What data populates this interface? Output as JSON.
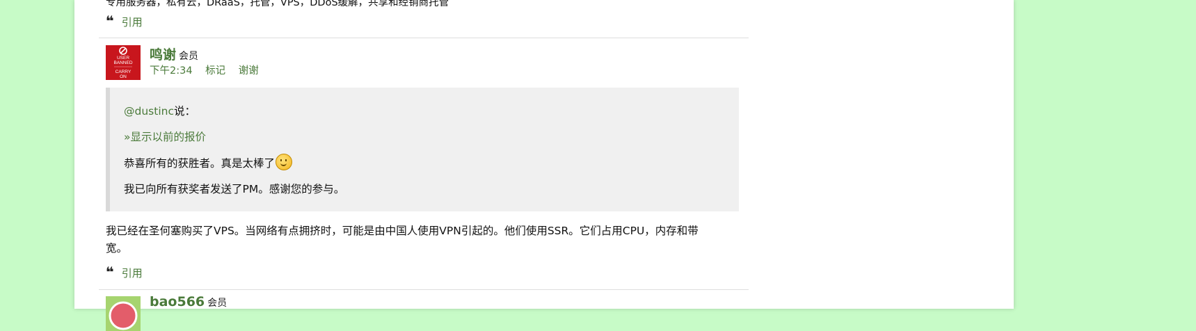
{
  "prev_post": {
    "text": "专用服务器，私有云，DRaaS，托管，VPS，DDoS缓解，共享和经销商托管",
    "quote_label": "引用"
  },
  "post1": {
    "username": "鸣谢",
    "role": "会员",
    "avatar_lines": [
      "USER",
      "BANNED",
      "CARRY",
      "ON"
    ],
    "time": "下午2:34",
    "mark_label": "标记",
    "thanks_label": "谢谢",
    "quote": {
      "author": "@dustinc",
      "said": "说：",
      "expand": "»显示以前的报价",
      "line1": "恭喜所有的获胜者。真是太棒了",
      "line2": "我已向所有获奖者发送了PM。感谢您的参与。"
    },
    "body_line1": "我已经在圣何塞购买了VPS。当网络有点拥挤时，可能是由中国人使用VPN引起的。他们使用SSR。它们占用CPU，内存和带",
    "body_line2": "宽。",
    "quote_label": "引用"
  },
  "post2": {
    "username": "bao566",
    "role": "会员"
  },
  "colors": {
    "background": "#c7fbc7",
    "link": "#4a7a3a",
    "quote_bg": "#f0f0f0",
    "avatar_red": "#c8161d"
  }
}
